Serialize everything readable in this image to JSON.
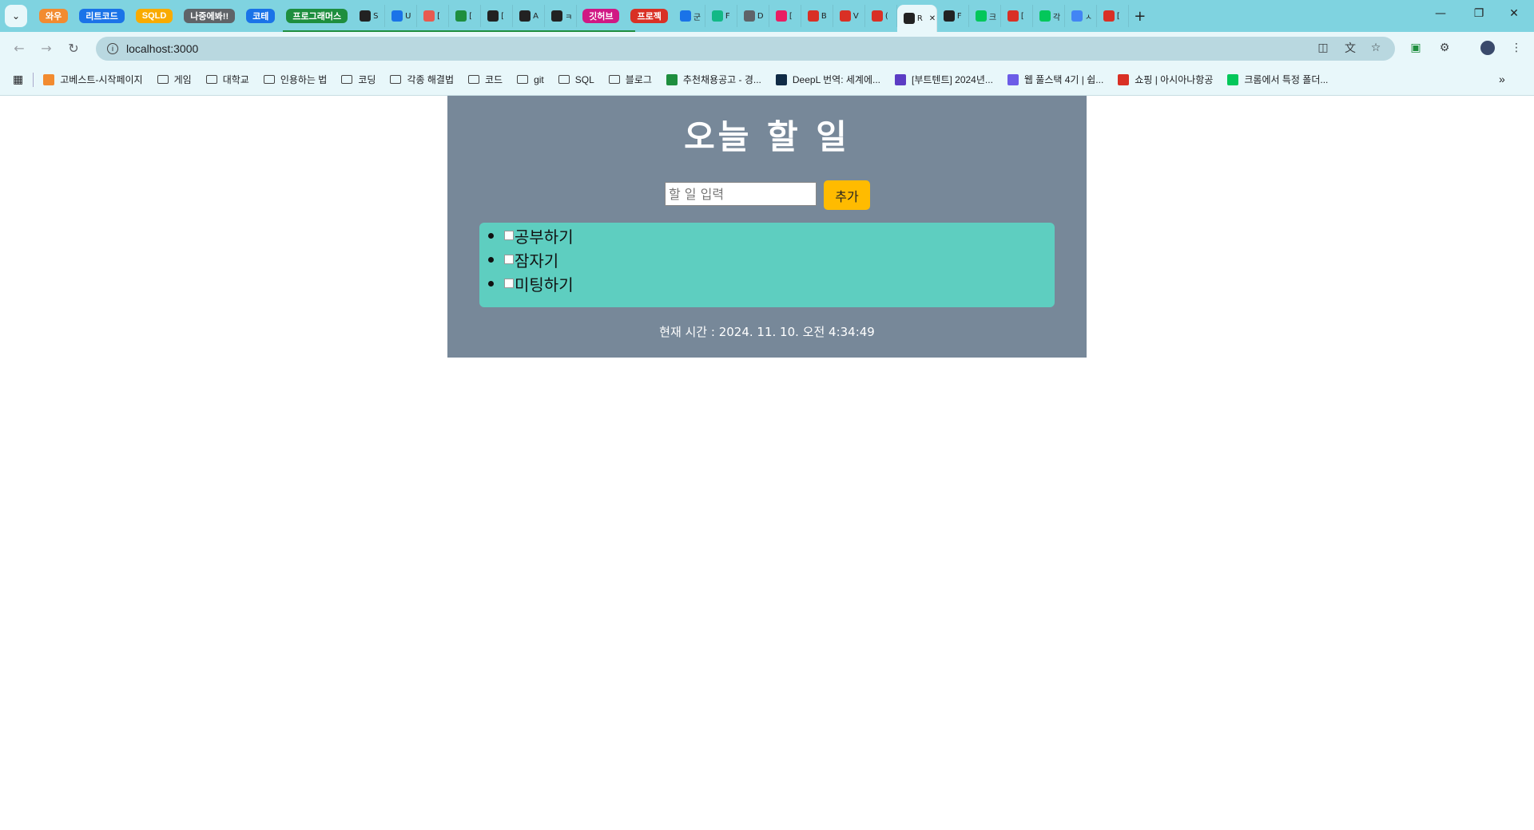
{
  "browser": {
    "tab_groups": [
      {
        "label": "와우",
        "color": "#f28b30"
      },
      {
        "label": "리트코드",
        "color": "#1a73e8"
      },
      {
        "label": "SQLD",
        "color": "#f9ab00"
      },
      {
        "label": "나중에봐!!",
        "color": "#5f6368"
      },
      {
        "label": "코테",
        "color": "#1a73e8"
      },
      {
        "label": "프로그래머스",
        "color": "#1e8e3e"
      }
    ],
    "mini_tabs": [
      {
        "letter": "S",
        "icon": "notion-icon",
        "color": "#222222"
      },
      {
        "letter": "U",
        "icon": "share-icon",
        "color": "#1a73e8"
      },
      {
        "letter": "[",
        "icon": "tomato-icon",
        "color": "#e85a4f"
      },
      {
        "letter": "[",
        "icon": "sheet-plus-icon",
        "color": "#1e8e3e"
      },
      {
        "letter": "[",
        "icon": "velog-icon",
        "color": "#222222"
      },
      {
        "letter": "A",
        "icon": "velog-icon",
        "color": "#222222"
      },
      {
        "letter": "ㅋ",
        "icon": "velog-icon",
        "color": "#222222"
      }
    ],
    "tab_groups_2": [
      {
        "label": "깃허브",
        "color": "#d01884"
      },
      {
        "label": "프로젝",
        "color": "#d93025"
      }
    ],
    "mini_tabs_2": [
      {
        "letter": "군",
        "icon": "compass-icon",
        "color": "#1a73e8"
      },
      {
        "letter": "F",
        "icon": "v-icon",
        "color": "#12b886"
      },
      {
        "letter": "D",
        "icon": "globe-icon",
        "color": "#5f6368"
      },
      {
        "letter": "[",
        "icon": "heart-icon",
        "color": "#e91e63"
      },
      {
        "letter": "B",
        "icon": "shield-icon",
        "color": "#d93025"
      },
      {
        "letter": "V",
        "icon": "shield-icon",
        "color": "#d93025"
      },
      {
        "letter": "(",
        "icon": "shield-icon",
        "color": "#d93025"
      },
      {
        "letter": "R",
        "icon": "react-icon",
        "color": "#222222",
        "active": true
      },
      {
        "letter": "F",
        "icon": "grid-icon",
        "color": "#222222"
      },
      {
        "letter": "크",
        "icon": "naver-icon",
        "color": "#03c75a"
      },
      {
        "letter": "[",
        "icon": "r-icon",
        "color": "#d93025"
      },
      {
        "letter": "각",
        "icon": "chat-icon",
        "color": "#03c75a"
      },
      {
        "letter": "ㅅ",
        "icon": "google-icon",
        "color": "#4285f4"
      },
      {
        "letter": "[",
        "icon": "r-icon",
        "color": "#d93025"
      }
    ],
    "new_tab_label": "+",
    "url": "localhost:3000",
    "bookmarks": [
      {
        "label": "고베스트-시작페이지",
        "type": "site",
        "color": "#f28b30"
      },
      {
        "label": "게임",
        "type": "folder"
      },
      {
        "label": "대학교",
        "type": "folder"
      },
      {
        "label": "인용하는 법",
        "type": "folder"
      },
      {
        "label": "코딩",
        "type": "folder"
      },
      {
        "label": "각종 해결법",
        "type": "folder"
      },
      {
        "label": "코드",
        "type": "folder"
      },
      {
        "label": "git",
        "type": "folder"
      },
      {
        "label": "SQL",
        "type": "folder"
      },
      {
        "label": "블로그",
        "type": "folder"
      },
      {
        "label": "추천채용공고 - 경...",
        "type": "site",
        "color": "#1e8e3e"
      },
      {
        "label": "DeepL 번역: 세계에...",
        "type": "site",
        "color": "#0f2b46"
      },
      {
        "label": "[부트텐트] 2024년...",
        "type": "site",
        "color": "#5b3cc4"
      },
      {
        "label": "웹 풀스택 4기 | 쉽...",
        "type": "site",
        "color": "#6c5ce7"
      },
      {
        "label": "쇼핑 | 아시아나항공",
        "type": "site",
        "color": "#d93025"
      },
      {
        "label": "크롬에서 특정 폴더...",
        "type": "site",
        "color": "#03c75a"
      }
    ]
  },
  "app": {
    "title": "오늘 할 일",
    "input_placeholder": "할 일 입력",
    "add_button": "추가",
    "todos": [
      "공부하기",
      "잠자기",
      "미팅하기"
    ],
    "clock_text": "현재 시간 : 2024. 11. 10. 오전 4:34:49"
  }
}
